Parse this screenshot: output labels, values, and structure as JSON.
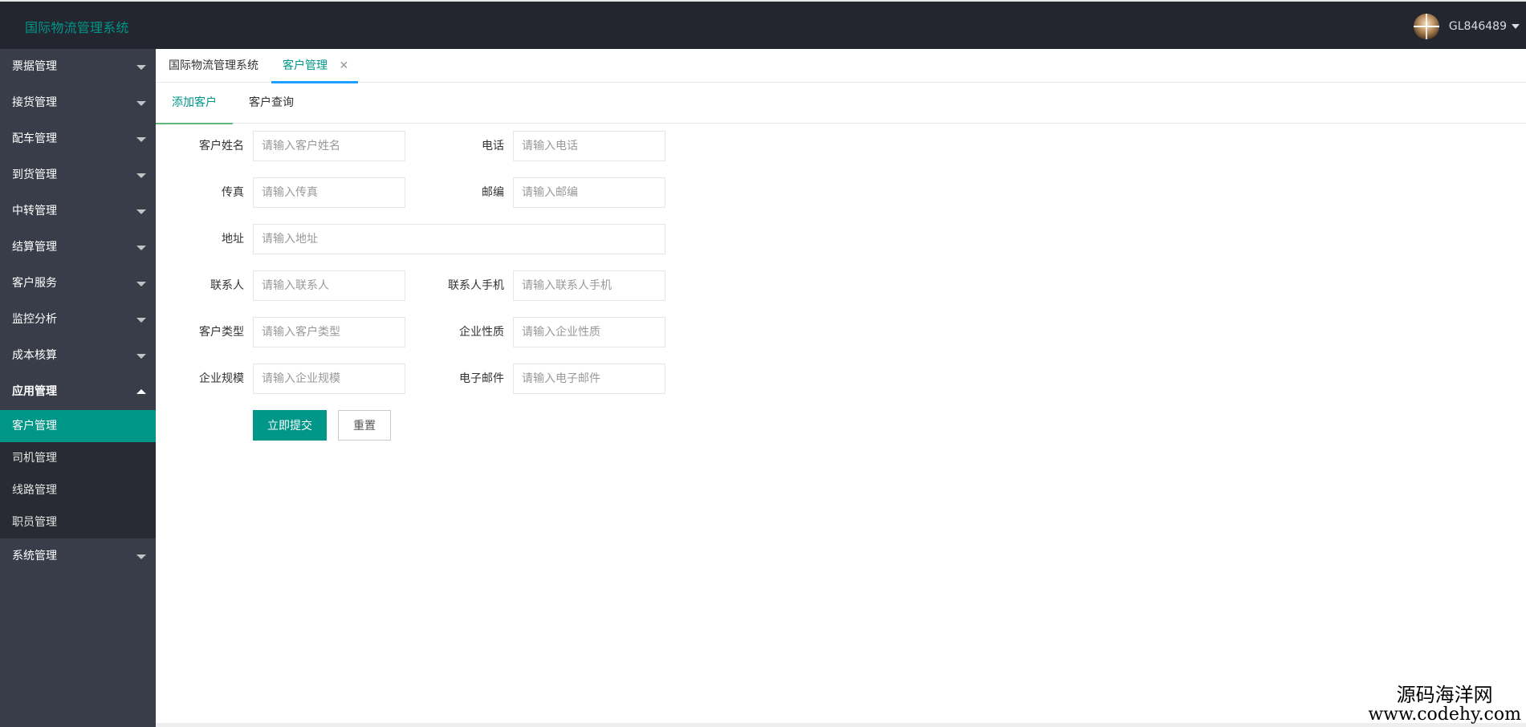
{
  "header": {
    "app_title": "国际物流管理系统",
    "username": "GL846489"
  },
  "sidebar": {
    "items": [
      {
        "label": "票据管理"
      },
      {
        "label": "接货管理"
      },
      {
        "label": "配车管理"
      },
      {
        "label": "到货管理"
      },
      {
        "label": "中转管理"
      },
      {
        "label": "结算管理"
      },
      {
        "label": "客户服务"
      },
      {
        "label": "监控分析"
      },
      {
        "label": "成本核算"
      },
      {
        "label": "应用管理",
        "open": true,
        "children": [
          {
            "label": "客户管理",
            "active": true
          },
          {
            "label": "司机管理"
          },
          {
            "label": "线路管理"
          },
          {
            "label": "职员管理"
          }
        ]
      },
      {
        "label": "系统管理"
      }
    ]
  },
  "tabs": {
    "home": "国际物流管理系统",
    "current": "客户管理",
    "close_glyph": "✕"
  },
  "subtabs": {
    "add": "添加客户",
    "query": "客户查询"
  },
  "form": {
    "name": {
      "label": "客户姓名",
      "placeholder": "请输入客户姓名",
      "value": ""
    },
    "phone": {
      "label": "电话",
      "placeholder": "请输入电话",
      "value": ""
    },
    "fax": {
      "label": "传真",
      "placeholder": "请输入传真",
      "value": ""
    },
    "postcode": {
      "label": "邮编",
      "placeholder": "请输入邮编",
      "value": ""
    },
    "address": {
      "label": "地址",
      "placeholder": "请输入地址",
      "value": ""
    },
    "contact": {
      "label": "联系人",
      "placeholder": "请输入联系人",
      "value": ""
    },
    "contact_mobile": {
      "label": "联系人手机",
      "placeholder": "请输入联系人手机",
      "value": ""
    },
    "customer_type": {
      "label": "客户类型",
      "placeholder": "请输入客户类型",
      "value": ""
    },
    "company_nature": {
      "label": "企业性质",
      "placeholder": "请输入企业性质",
      "value": ""
    },
    "company_scale": {
      "label": "企业规模",
      "placeholder": "请输入企业规模",
      "value": ""
    },
    "email": {
      "label": "电子邮件",
      "placeholder": "请输入电子邮件",
      "value": ""
    },
    "submit_label": "立即提交",
    "reset_label": "重置"
  },
  "watermark": {
    "cn": "源码海洋网",
    "url": "www.codehy.com"
  },
  "colors": {
    "header_bg": "#23262e",
    "sidebar_bg": "#393d49",
    "submenu_bg": "#282b33",
    "accent": "#009688",
    "tab_underline": "#1e9fff"
  }
}
